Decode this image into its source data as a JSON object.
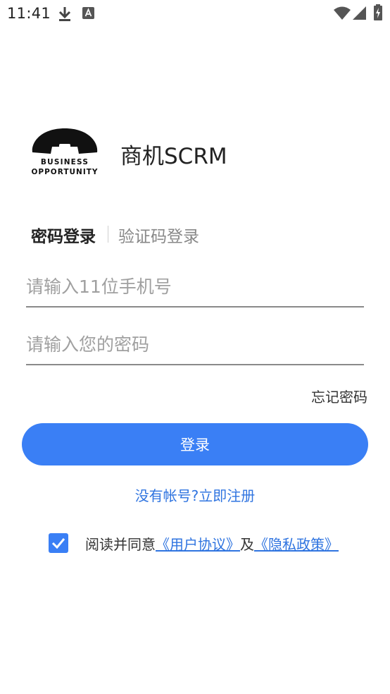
{
  "status_bar": {
    "time": "11:41",
    "icons": [
      "download-icon",
      "a-icon",
      "wifi-icon",
      "signal-icon",
      "battery-charging-icon"
    ]
  },
  "app": {
    "logo_line1": "BUSINESS",
    "logo_line2": "OPPORTUNITY",
    "name": "商机SCRM"
  },
  "tabs": [
    {
      "label": "密码登录",
      "active": true
    },
    {
      "label": "验证码登录",
      "active": false
    }
  ],
  "form": {
    "phone": {
      "value": "",
      "placeholder": "请输入11位手机号"
    },
    "password": {
      "value": "",
      "placeholder": "请输入您的密码"
    },
    "forgot_label": "忘记密码",
    "login_label": "登录"
  },
  "register_link": "没有帐号?立即注册",
  "agreement": {
    "checked": true,
    "prefix": "阅读并同意",
    "user_agreement": "《用户协议》",
    "connector": "及",
    "privacy_policy": "《隐私政策》"
  },
  "colors": {
    "accent": "#3a7ff5",
    "link": "#2f74e0"
  }
}
